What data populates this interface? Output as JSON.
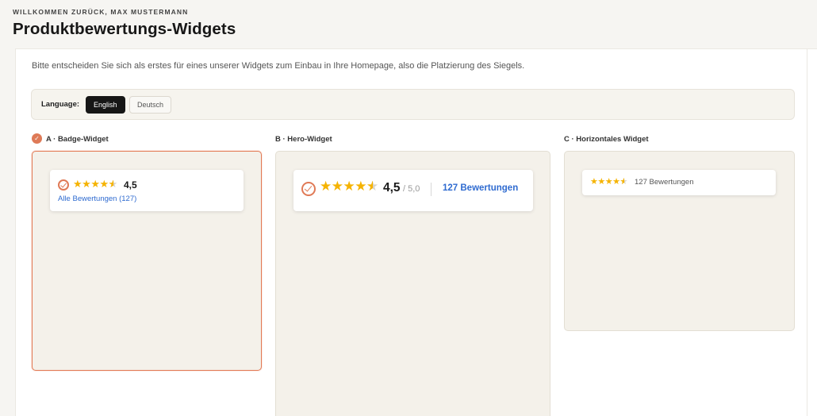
{
  "header": {
    "welcome": "WILLKOMMEN ZURÜCK, MAX MUSTERMANN",
    "title": "Produktbewertungs-Widgets"
  },
  "intro": "Bitte entscheiden Sie sich als erstes für eines unserer Widgets zum Einbau in Ihre Homepage, also die Platzierung des Siegels.",
  "language": {
    "label": "Language:",
    "options": [
      "English",
      "Deutsch"
    ],
    "selected": "English"
  },
  "widgets": [
    {
      "label": "A · Badge-Widget",
      "selected": true,
      "rating": "4,5",
      "stars": 4.5,
      "link": "Alle Bewertungen (127)"
    },
    {
      "label": "B · Hero-Widget",
      "selected": false,
      "rating": "4,5",
      "out_of": "/ 5,0",
      "stars": 4.5,
      "link": "127 Bewertungen"
    },
    {
      "label": "C · Horizontales Widget",
      "selected": false,
      "stars": 4.5,
      "count": "127 Bewertungen"
    }
  ],
  "colors": {
    "accent": "#e27a55",
    "star": "#f5b301",
    "link": "#2f6bd0",
    "card_bg": "#f4f1ea"
  },
  "icons": {
    "selected": "check-circle-icon",
    "seal": "seal-check-icon",
    "star": "star-icon"
  }
}
